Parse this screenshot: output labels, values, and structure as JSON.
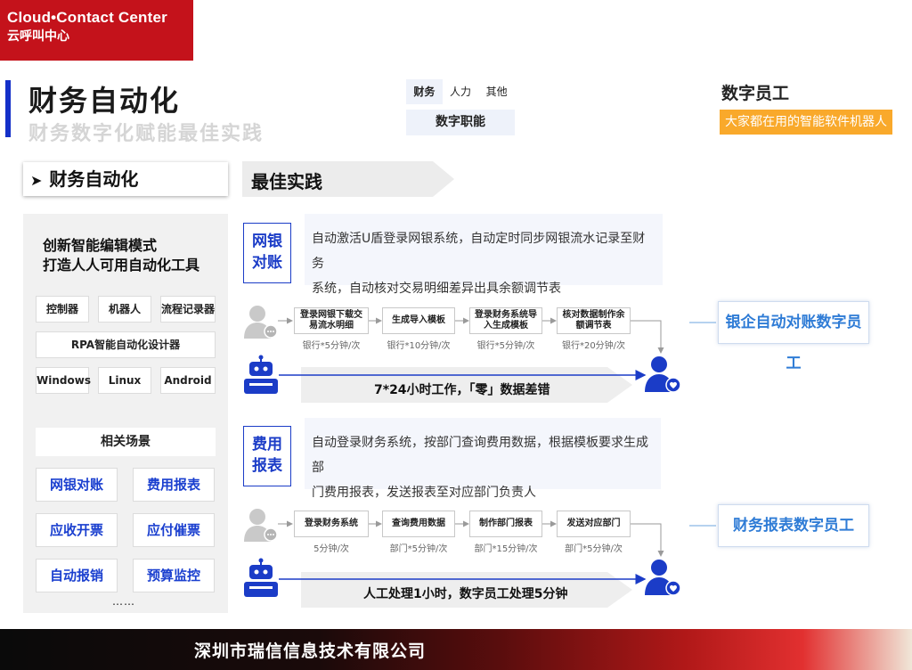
{
  "logo": {
    "line1": "Cloud•Contact Center",
    "line2": "云呼叫中心"
  },
  "header": {
    "title": "财务自动化",
    "subtitle": "财务数字化赋能最佳实践"
  },
  "tabs": {
    "items": [
      "财务",
      "人力",
      "其他"
    ],
    "active": "财务"
  },
  "digital_role": "数字职能",
  "digital_employee": {
    "title": "数字员工",
    "badge": "大家都在用的智能软件机器人"
  },
  "left_section": {
    "header": "财务自动化",
    "intro_line1": "创新智能编辑模式",
    "intro_line2": "打造人人可用自动化工具",
    "tools_row1": [
      "控制器",
      "机器人",
      "流程记录器"
    ],
    "designer": "RPA智能自动化设计器",
    "platforms": [
      "Windows",
      "Linux",
      "Android"
    ],
    "related_title": "相关场景",
    "scenes": [
      "网银对账",
      "费用报表",
      "应收开票",
      "应付催票",
      "自动报销",
      "预算监控"
    ],
    "more": "……"
  },
  "right_section": {
    "header": "最佳实践"
  },
  "scenario1": {
    "label_line1": "网银",
    "label_line2": "对账",
    "desc_line1": "自动激活U盾登录网银系统，自动定时同步网银流水记录至财务",
    "desc_line2": "系统，自动核对交易明细差异出具余额调节表",
    "steps": [
      {
        "line1": "登录网银下载交",
        "line2": "易流水明细",
        "sub": "银行*5分钟/次"
      },
      {
        "line1": "生成导入模板",
        "line2": "",
        "sub": "银行*10分钟/次"
      },
      {
        "line1": "登录财务系统导",
        "line2": "入生成模板",
        "sub": "银行*5分钟/次"
      },
      {
        "line1": "核对数据制作余",
        "line2": "额调节表",
        "sub": "银行*20分钟/次"
      }
    ],
    "banner": "7*24小时工作，「零」数据差错",
    "card": "银企自动对账数字员工"
  },
  "scenario2": {
    "label_line1": "费用",
    "label_line2": "报表",
    "desc_line1": "自动登录财务系统，按部门查询费用数据，根据模板要求生成部",
    "desc_line2": "门费用报表，发送报表至对应部门负责人",
    "steps": [
      {
        "line1": "登录财务系统",
        "line2": "",
        "sub": "5分钟/次"
      },
      {
        "line1": "查询费用数据",
        "line2": "",
        "sub": "部门*5分钟/次"
      },
      {
        "line1": "制作部门报表",
        "line2": "",
        "sub": "部门*15分钟/次"
      },
      {
        "line1": "发送对应部门",
        "line2": "",
        "sub": "部门*5分钟/次"
      }
    ],
    "banner": "人工处理1小时，数字员工处理5分钟",
    "card": "财务报表数字员工"
  },
  "footer": {
    "company": "深圳市瑞信信息技术有限公司"
  },
  "colors": {
    "brand_red": "#c4121b",
    "accent_blue": "#1b3cc7",
    "badge_orange": "#f9a92b",
    "card_blue": "#2f7cd6"
  }
}
